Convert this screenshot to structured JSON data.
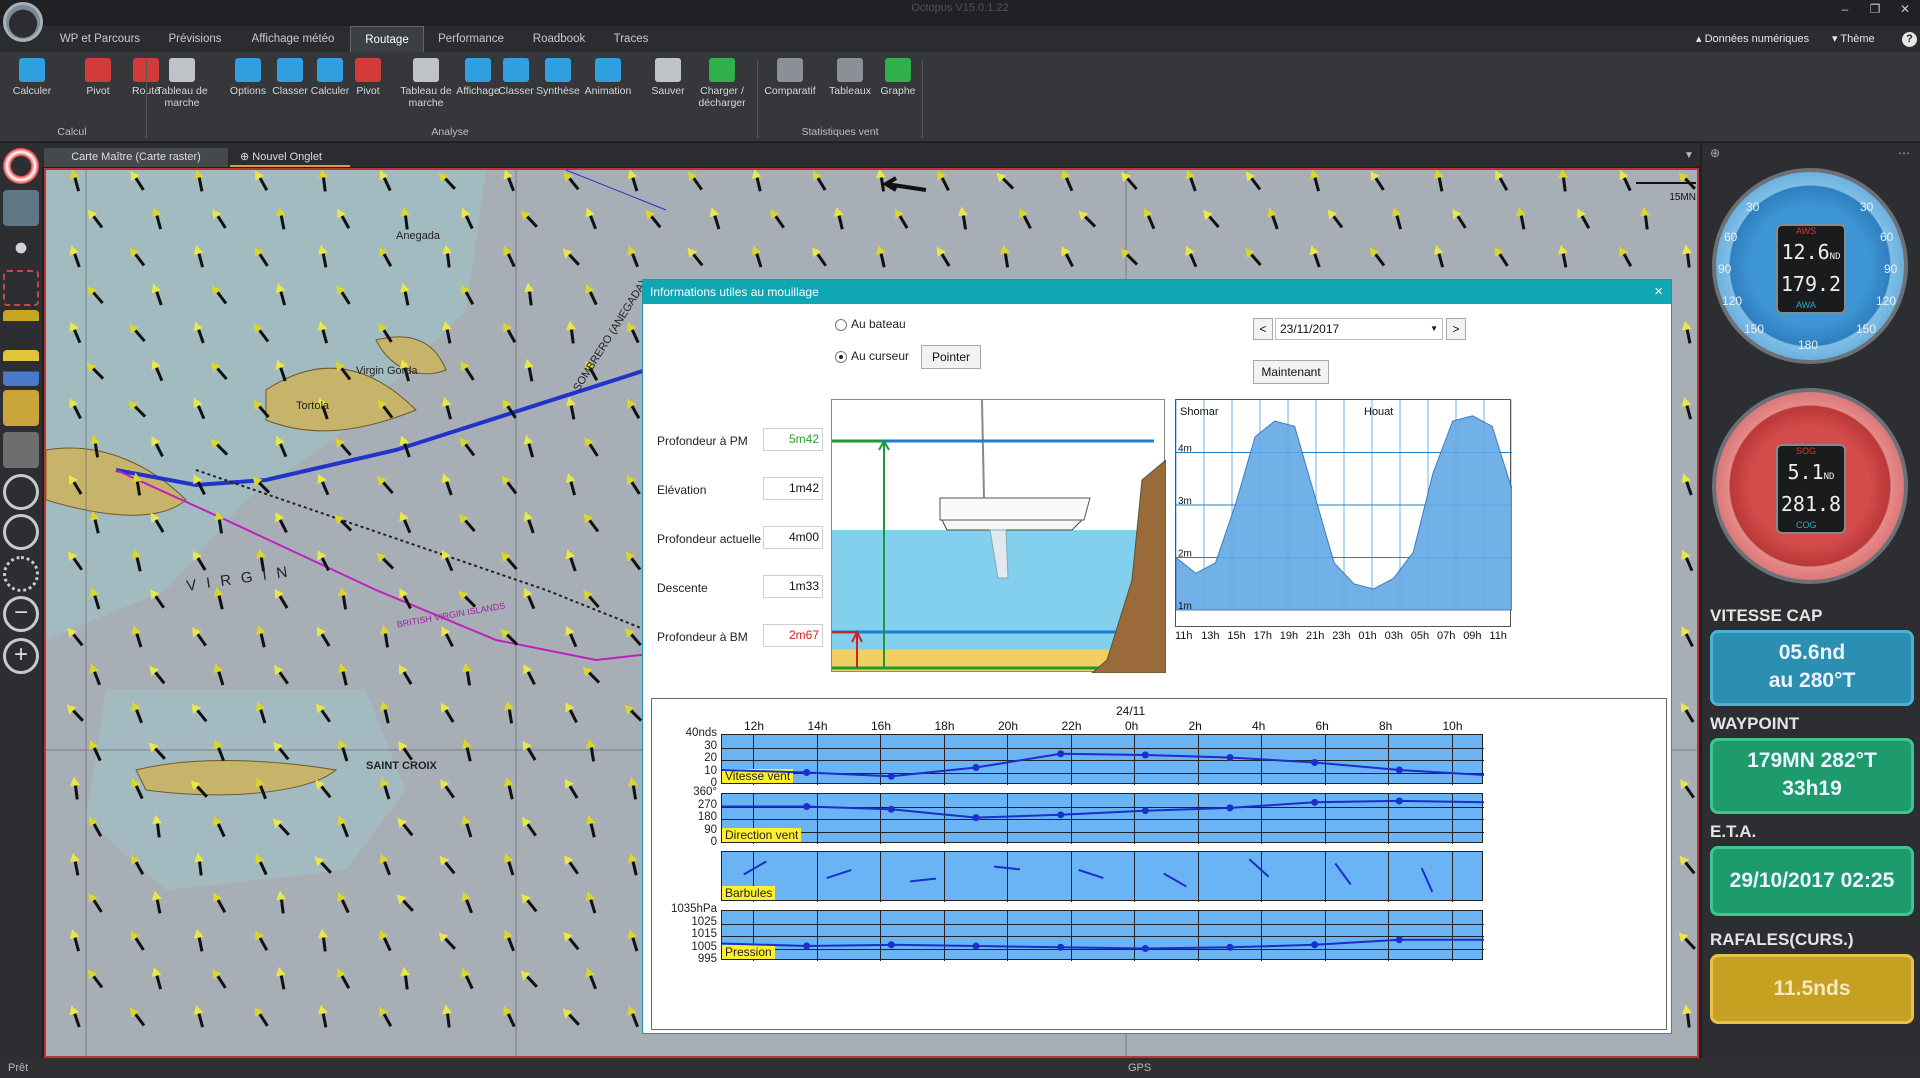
{
  "app": {
    "title": "Octopus V15.0.1.22"
  },
  "window_controls": {
    "minimize": "–",
    "restore": "❐",
    "close": "✕"
  },
  "menu": {
    "tabs": [
      {
        "label": "WP et Parcours"
      },
      {
        "label": "Prévisions"
      },
      {
        "label": "Affichage météo"
      },
      {
        "label": "Routage"
      },
      {
        "label": "Performance"
      },
      {
        "label": "Roadbook"
      },
      {
        "label": "Traces"
      }
    ],
    "active_tab": "Routage",
    "right": {
      "numeric": "Données numériques",
      "theme": "Thème",
      "help": "?"
    }
  },
  "ribbon": {
    "groups": [
      {
        "label": "Calcul",
        "buttons": [
          {
            "label": "Calculer",
            "icon": "percent-icon"
          },
          {
            "label": "Pivot",
            "icon": "pivot-icon"
          },
          {
            "label": "Route",
            "icon": "route-icon"
          }
        ]
      },
      {
        "label": "Analyse",
        "buttons": [
          {
            "label": "Tableau de marche",
            "icon": "table-icon"
          },
          {
            "label": "Options",
            "icon": "gear-icon"
          },
          {
            "label": "Classer",
            "icon": "sort-icon"
          },
          {
            "label": "Calculer",
            "icon": "percent-icon"
          },
          {
            "label": "Pivot",
            "icon": "pivot-icon"
          },
          {
            "label": "Tableau de marche",
            "icon": "table-icon"
          },
          {
            "label": "Affichage",
            "icon": "gear-icon"
          },
          {
            "label": "Classer",
            "icon": "sort-icon"
          },
          {
            "label": "Synthèse",
            "icon": "list-icon"
          },
          {
            "label": "Animation",
            "icon": "play-icon"
          },
          {
            "label": "Sauver",
            "icon": "save-icon"
          },
          {
            "label": "Charger / décharger",
            "icon": "load-icon"
          }
        ]
      },
      {
        "label": "Statistiques vent",
        "buttons": [
          {
            "label": "Comparatif",
            "icon": "compare-icon"
          },
          {
            "label": "Tableaux",
            "icon": "tables-icon"
          },
          {
            "label": "Graphe",
            "icon": "graph-icon"
          }
        ]
      }
    ]
  },
  "doc_tabs": [
    {
      "label": "Carte Maître (Carte raster)"
    },
    {
      "label": "Nouvel Onglet"
    }
  ],
  "chart_labels": {
    "scale": "15MN",
    "places": [
      "Anegada",
      "Virgin Gorda",
      "Tortola",
      "SAINT CROIX",
      "VIRGIN",
      "SOMBRERO (ANEGADA)",
      "BRITISH VIRGIN ISLANDS"
    ]
  },
  "dialog": {
    "title": "Informations utiles au mouillage",
    "close": "×",
    "radio_boat": "Au bateau",
    "radio_cursor": "Au curseur",
    "radio_selected": "cursor",
    "pointer_btn": "Pointer",
    "date": "23/11/2017",
    "prev": "<",
    "next": ">",
    "now_btn": "Maintenant",
    "rows": [
      {
        "label": "Profondeur à PM",
        "value": "5m42",
        "color": "#2e9c2e"
      },
      {
        "label": "Elévation",
        "value": "1m42",
        "color": "#111111"
      },
      {
        "label": "Profondeur actuelle",
        "value": "4m00",
        "color": "#111111"
      },
      {
        "label": "Descente",
        "value": "1m33",
        "color": "#111111"
      },
      {
        "label": "Profondeur à BM",
        "value": "2m67",
        "color": "#d02020"
      }
    ],
    "tide_graph": {
      "stations": [
        "Shomar",
        "Houat"
      ],
      "yticks": [
        "4m",
        "3m",
        "2m",
        "1m"
      ],
      "xticks": [
        "11h",
        "13h",
        "15h",
        "17h",
        "19h",
        "21h",
        "23h",
        "01h",
        "03h",
        "05h",
        "07h",
        "09h",
        "11h"
      ]
    },
    "weather": {
      "day_label": "24/11",
      "xticks": [
        "12h",
        "14h",
        "16h",
        "18h",
        "20h",
        "22h",
        "0h",
        "2h",
        "4h",
        "6h",
        "8h",
        "10h"
      ],
      "panels": [
        {
          "label": "Vitesse vent",
          "yticks": [
            "40nds",
            "30",
            "20",
            "10",
            "0"
          ]
        },
        {
          "label": "Direction vent",
          "yticks": [
            "360°",
            "270",
            "180",
            "90",
            "0"
          ]
        },
        {
          "label": "Barbules",
          "yticks": []
        },
        {
          "label": "Pression",
          "yticks": [
            "1035hPa",
            "1025",
            "1015",
            "1005",
            "995"
          ]
        }
      ]
    }
  },
  "chart_data": [
    {
      "type": "area",
      "title": "",
      "xlabel": "",
      "ylabel": "",
      "x": [
        "11h",
        "12h",
        "13h",
        "15h",
        "17h",
        "18h",
        "19h",
        "21h",
        "23h",
        "00h",
        "01h",
        "02h",
        "03h",
        "05h",
        "07h",
        "08h",
        "09h",
        "11h"
      ],
      "values": [
        2.0,
        1.7,
        1.9,
        3.0,
        4.3,
        4.6,
        4.5,
        3.2,
        1.9,
        1.5,
        1.4,
        1.6,
        2.1,
        3.6,
        4.6,
        4.7,
        4.5,
        3.3
      ],
      "ylim": [
        1,
        5
      ],
      "grid": true,
      "fill_color": "#62a9e6"
    },
    {
      "type": "line",
      "title": "Vitesse vent",
      "categories": [
        "11h",
        "12h",
        "15h",
        "18h",
        "21h",
        "0h",
        "3h",
        "6h",
        "9h",
        "11h"
      ],
      "series": [
        {
          "name": "Vitesse vent",
          "values": [
            12,
            10,
            7,
            14,
            25,
            24,
            22,
            18,
            12,
            8
          ]
        }
      ],
      "ylim": [
        0,
        40
      ]
    },
    {
      "type": "line",
      "title": "Direction vent",
      "categories": [
        "11h",
        "12h",
        "15h",
        "18h",
        "21h",
        "0h",
        "3h",
        "6h",
        "9h",
        "11h"
      ],
      "series": [
        {
          "name": "Direction vent",
          "values": [
            270,
            270,
            250,
            190,
            210,
            240,
            260,
            300,
            310,
            300
          ]
        }
      ],
      "ylim": [
        0,
        360
      ]
    },
    {
      "type": "line",
      "title": "Pression",
      "categories": [
        "11h",
        "12h",
        "15h",
        "18h",
        "21h",
        "0h",
        "3h",
        "6h",
        "9h",
        "11h"
      ],
      "series": [
        {
          "name": "Pression",
          "values": [
            1009,
            1007,
            1008,
            1007,
            1006,
            1005,
            1006,
            1008,
            1012,
            1012
          ]
        }
      ],
      "ylim": [
        995,
        1035
      ]
    }
  ],
  "instruments": {
    "wind_gauge": {
      "top": "AWS",
      "bottom": "AWA",
      "speed": "12.6",
      "speed_unit": "ND",
      "angle": "179.2",
      "ticks": [
        "30",
        "60",
        "90",
        "120",
        "150",
        "180"
      ]
    },
    "boat_gauge": {
      "top": "SOG",
      "bottom": "COG",
      "speed": "5.1",
      "speed_unit": "ND",
      "angle": "281.8"
    },
    "vitesse_cap": {
      "title": "VITESSE CAP",
      "line1": "05.6nd",
      "line2": "au 280°T"
    },
    "waypoint": {
      "title": "WAYPOINT",
      "line1": "179MN 282°T",
      "line2": "33h19"
    },
    "eta": {
      "title": "E.T.A.",
      "value": "29/10/2017 02:25"
    },
    "rafales": {
      "title": "RAFALES(CURS.)",
      "value": "11.5nds"
    }
  },
  "status": {
    "left": "Prêt",
    "center": "GPS"
  },
  "colors": {
    "accent": "#10a6b4",
    "route": "#2233cc",
    "magenta_route": "#c020c0",
    "vitesse_box": "#2a8fb0",
    "waypoint_box": "#1e9b6c",
    "eta_box": "#1e9b6c",
    "rafales_box": "#c6a020"
  }
}
